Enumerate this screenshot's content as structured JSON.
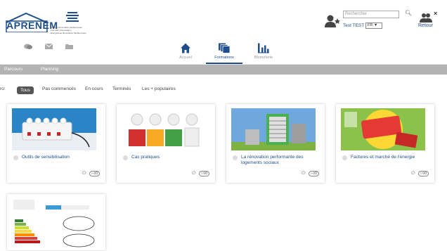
{
  "header": {
    "logo_text": "APRENEM",
    "logo2_sub": [
      "Energie Renovation Mediterranee",
      "Formation Renovation",
      "Energetique Renovation Mediterranee"
    ],
    "search_placeholder": "Rechercher",
    "user_name": "Test TEST",
    "lang": "FR ▼",
    "retour_label": "Retour"
  },
  "nav": {
    "items": [
      {
        "label": "Accueil",
        "icon": "home-icon"
      },
      {
        "label": "Formations",
        "icon": "formations-icon"
      },
      {
        "label": "Blométerie",
        "icon": "chart-icon"
      }
    ],
    "active": "Formations"
  },
  "subnav": {
    "items": [
      "Parcours",
      "Planning"
    ]
  },
  "filters": {
    "prefix": "ro:",
    "items": [
      "Tous",
      "Pas commencés",
      "En cours",
      "Terminés",
      "Les + populaires"
    ],
    "active": "Tous"
  },
  "cards": [
    {
      "title": "Outils de sensibilisation",
      "likes": "0"
    },
    {
      "title": "Cas pratiques",
      "likes": "0"
    },
    {
      "title": "La rénovation performante des logements sociaux",
      "likes": "0"
    },
    {
      "title": "Factures et marché de l'énergie",
      "likes": "0"
    }
  ],
  "colors": {
    "brand": "#1f4e8c",
    "subnav": "#b3b3b3"
  }
}
